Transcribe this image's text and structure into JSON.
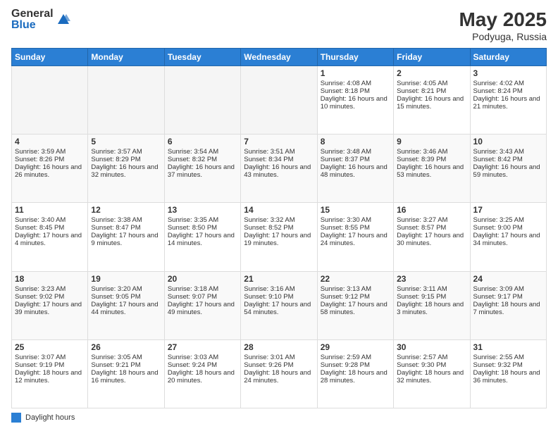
{
  "header": {
    "logo_general": "General",
    "logo_blue": "Blue",
    "title": "May 2025",
    "location": "Podyuga, Russia"
  },
  "footer": {
    "legend_label": "Daylight hours"
  },
  "days_of_week": [
    "Sunday",
    "Monday",
    "Tuesday",
    "Wednesday",
    "Thursday",
    "Friday",
    "Saturday"
  ],
  "weeks": [
    [
      {
        "day": "",
        "info": ""
      },
      {
        "day": "",
        "info": ""
      },
      {
        "day": "",
        "info": ""
      },
      {
        "day": "",
        "info": ""
      },
      {
        "day": "1",
        "info": "Sunrise: 4:08 AM\nSunset: 8:18 PM\nDaylight: 16 hours and 10 minutes."
      },
      {
        "day": "2",
        "info": "Sunrise: 4:05 AM\nSunset: 8:21 PM\nDaylight: 16 hours and 15 minutes."
      },
      {
        "day": "3",
        "info": "Sunrise: 4:02 AM\nSunset: 8:24 PM\nDaylight: 16 hours and 21 minutes."
      }
    ],
    [
      {
        "day": "4",
        "info": "Sunrise: 3:59 AM\nSunset: 8:26 PM\nDaylight: 16 hours and 26 minutes."
      },
      {
        "day": "5",
        "info": "Sunrise: 3:57 AM\nSunset: 8:29 PM\nDaylight: 16 hours and 32 minutes."
      },
      {
        "day": "6",
        "info": "Sunrise: 3:54 AM\nSunset: 8:32 PM\nDaylight: 16 hours and 37 minutes."
      },
      {
        "day": "7",
        "info": "Sunrise: 3:51 AM\nSunset: 8:34 PM\nDaylight: 16 hours and 43 minutes."
      },
      {
        "day": "8",
        "info": "Sunrise: 3:48 AM\nSunset: 8:37 PM\nDaylight: 16 hours and 48 minutes."
      },
      {
        "day": "9",
        "info": "Sunrise: 3:46 AM\nSunset: 8:39 PM\nDaylight: 16 hours and 53 minutes."
      },
      {
        "day": "10",
        "info": "Sunrise: 3:43 AM\nSunset: 8:42 PM\nDaylight: 16 hours and 59 minutes."
      }
    ],
    [
      {
        "day": "11",
        "info": "Sunrise: 3:40 AM\nSunset: 8:45 PM\nDaylight: 17 hours and 4 minutes."
      },
      {
        "day": "12",
        "info": "Sunrise: 3:38 AM\nSunset: 8:47 PM\nDaylight: 17 hours and 9 minutes."
      },
      {
        "day": "13",
        "info": "Sunrise: 3:35 AM\nSunset: 8:50 PM\nDaylight: 17 hours and 14 minutes."
      },
      {
        "day": "14",
        "info": "Sunrise: 3:32 AM\nSunset: 8:52 PM\nDaylight: 17 hours and 19 minutes."
      },
      {
        "day": "15",
        "info": "Sunrise: 3:30 AM\nSunset: 8:55 PM\nDaylight: 17 hours and 24 minutes."
      },
      {
        "day": "16",
        "info": "Sunrise: 3:27 AM\nSunset: 8:57 PM\nDaylight: 17 hours and 30 minutes."
      },
      {
        "day": "17",
        "info": "Sunrise: 3:25 AM\nSunset: 9:00 PM\nDaylight: 17 hours and 34 minutes."
      }
    ],
    [
      {
        "day": "18",
        "info": "Sunrise: 3:23 AM\nSunset: 9:02 PM\nDaylight: 17 hours and 39 minutes."
      },
      {
        "day": "19",
        "info": "Sunrise: 3:20 AM\nSunset: 9:05 PM\nDaylight: 17 hours and 44 minutes."
      },
      {
        "day": "20",
        "info": "Sunrise: 3:18 AM\nSunset: 9:07 PM\nDaylight: 17 hours and 49 minutes."
      },
      {
        "day": "21",
        "info": "Sunrise: 3:16 AM\nSunset: 9:10 PM\nDaylight: 17 hours and 54 minutes."
      },
      {
        "day": "22",
        "info": "Sunrise: 3:13 AM\nSunset: 9:12 PM\nDaylight: 17 hours and 58 minutes."
      },
      {
        "day": "23",
        "info": "Sunrise: 3:11 AM\nSunset: 9:15 PM\nDaylight: 18 hours and 3 minutes."
      },
      {
        "day": "24",
        "info": "Sunrise: 3:09 AM\nSunset: 9:17 PM\nDaylight: 18 hours and 7 minutes."
      }
    ],
    [
      {
        "day": "25",
        "info": "Sunrise: 3:07 AM\nSunset: 9:19 PM\nDaylight: 18 hours and 12 minutes."
      },
      {
        "day": "26",
        "info": "Sunrise: 3:05 AM\nSunset: 9:21 PM\nDaylight: 18 hours and 16 minutes."
      },
      {
        "day": "27",
        "info": "Sunrise: 3:03 AM\nSunset: 9:24 PM\nDaylight: 18 hours and 20 minutes."
      },
      {
        "day": "28",
        "info": "Sunrise: 3:01 AM\nSunset: 9:26 PM\nDaylight: 18 hours and 24 minutes."
      },
      {
        "day": "29",
        "info": "Sunrise: 2:59 AM\nSunset: 9:28 PM\nDaylight: 18 hours and 28 minutes."
      },
      {
        "day": "30",
        "info": "Sunrise: 2:57 AM\nSunset: 9:30 PM\nDaylight: 18 hours and 32 minutes."
      },
      {
        "day": "31",
        "info": "Sunrise: 2:55 AM\nSunset: 9:32 PM\nDaylight: 18 hours and 36 minutes."
      }
    ]
  ]
}
